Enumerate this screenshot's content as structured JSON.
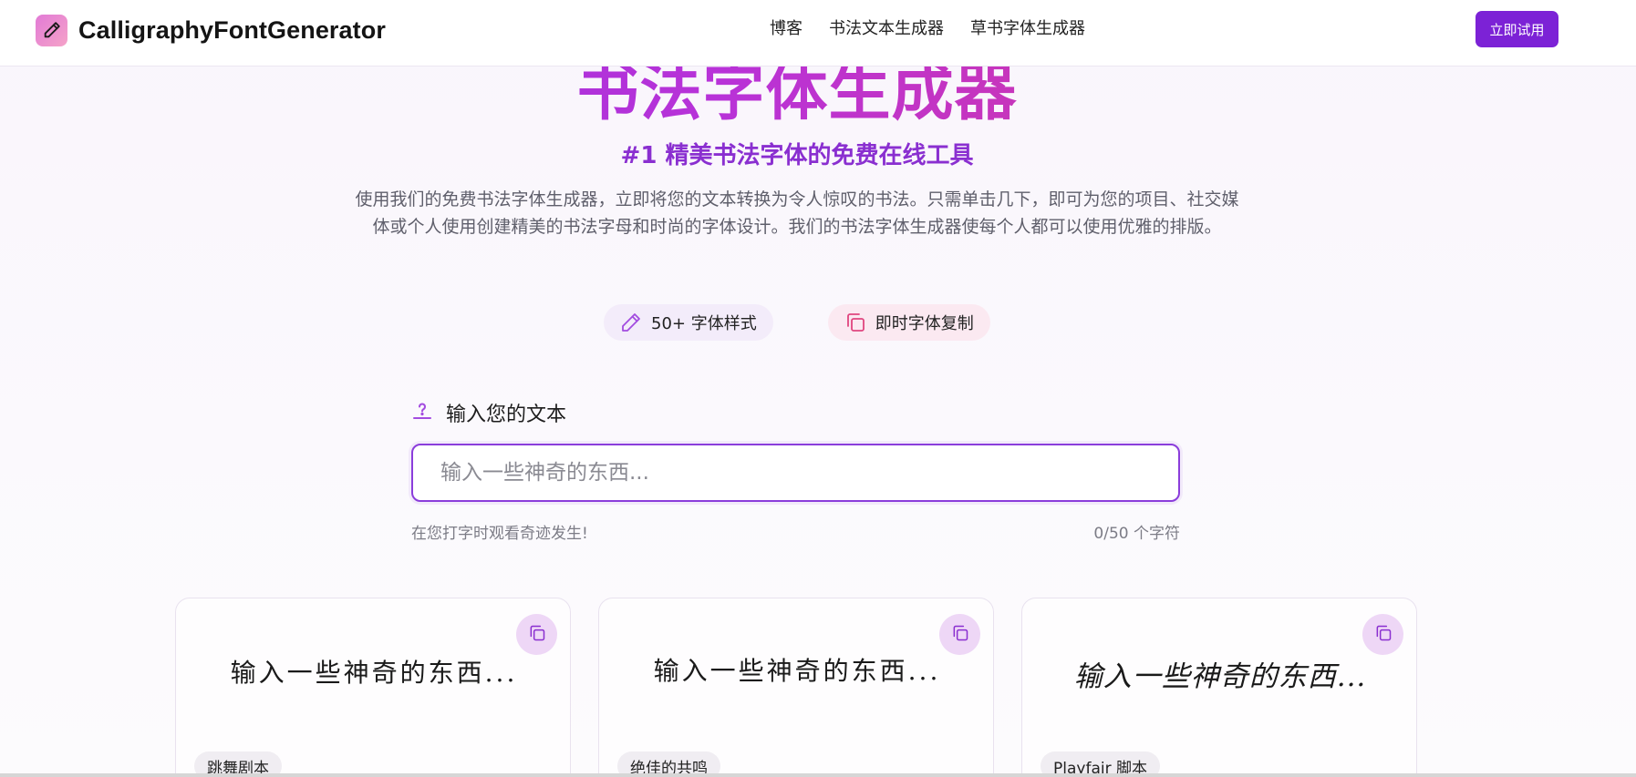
{
  "header": {
    "logo_text": "CalligraphyFontGenerator",
    "nav": [
      "博客",
      "书法文本生成器",
      "草书字体生成器"
    ],
    "cta_label": "立即试用"
  },
  "hero": {
    "title": "书法字体生成器",
    "subtitle": "#1 精美书法字体的免费在线工具",
    "description": "使用我们的免费书法字体生成器，立即将您的文本转换为令人惊叹的书法。只需单击几下，即可为您的项目、社交媒体或个人使用创建精美的书法字母和时尚的字体设计。我们的书法字体生成器使每个人都可以使用优雅的排版。"
  },
  "features": [
    {
      "icon": "pencil-icon",
      "label": "50+ 字体样式"
    },
    {
      "icon": "copy-icon",
      "label": "即时字体复制"
    }
  ],
  "input": {
    "label": "输入您的文本",
    "placeholder": "输入一些神奇的东西...",
    "value": "",
    "hint": "在您打字时观看奇迹发生!",
    "counter": "0/50 个字符"
  },
  "cards": [
    {
      "preview": "输入一些神奇的东西...",
      "style_name": "跳舞剧本"
    },
    {
      "preview": "输入一些神奇的东西...",
      "style_name": "绝佳的共鸣"
    },
    {
      "preview": "输入一些神奇的东西...",
      "style_name": "Playfair 脚本"
    }
  ],
  "colors": {
    "accent": "#7c22d6",
    "title_gradient_start": "#8f2fe0",
    "title_gradient_end": "#e33b86",
    "subtitle": "#8a2fd0"
  }
}
